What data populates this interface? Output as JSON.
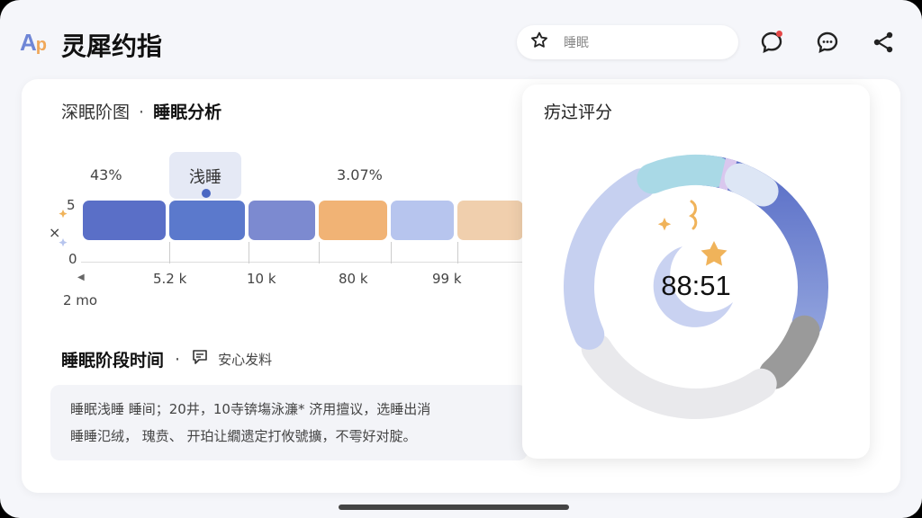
{
  "app": {
    "logo_a": "A",
    "logo_p": "p",
    "title": "灵犀约指"
  },
  "search": {
    "query": "睡眠"
  },
  "breadcrumb": {
    "parent": "深眠阶图",
    "separator": "·",
    "current": "睡眠分析"
  },
  "chart_data": {
    "type": "bar",
    "tooltip": "浅睡",
    "percent_labels": [
      "43%",
      "3.07%"
    ],
    "y_ticks": [
      "5",
      "0"
    ],
    "y_axis_mark": "×",
    "x_ticks": [
      "5.2 k",
      "10 k",
      "80 k",
      "99 k"
    ],
    "x_unit_label": "2 mo",
    "segments": [
      {
        "color": "#5a6fc7"
      },
      {
        "color": "#5b79cc"
      },
      {
        "color": "#7c8ad0"
      },
      {
        "color": "#f1b375"
      },
      {
        "color": "#b7c5ee"
      },
      {
        "color": "#f0cfad"
      }
    ]
  },
  "section2": {
    "title": "睡眠阶段时间",
    "separator": "·",
    "link_label": "安心发料"
  },
  "note": {
    "line1": "睡眠浅睡 睡间；20井，10寺锛塲泳濂* 济用擅议，选睡出消",
    "line2": "睡睡氾绒， 瑰贲、 开珀让繝遗定打攸號擴，不雩好对腚。"
  },
  "score": {
    "title": "疠过评分",
    "value": "88:51",
    "ring_colors": [
      "#5a6fc7",
      "#8aa0dc",
      "#9a9a9a",
      "#e9e9ec",
      "#c6d0f0",
      "#a9d9e6",
      "#d9c7ee",
      "#dde6f5"
    ]
  },
  "colors": {
    "accent": "#5a6fc7",
    "orange": "#f1b375",
    "star": "#f0b35a"
  }
}
